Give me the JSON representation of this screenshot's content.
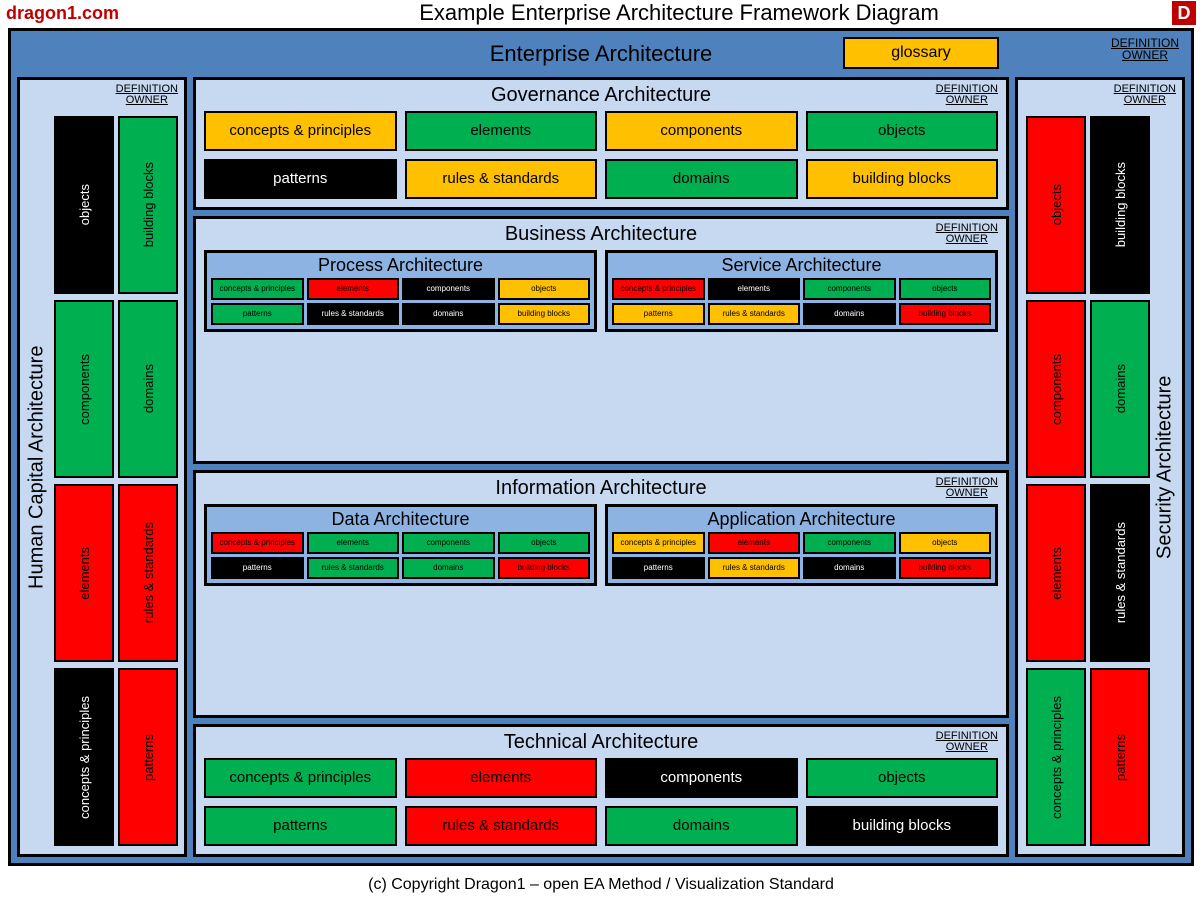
{
  "brand": "dragon1.com",
  "logo": "D",
  "page_title": "Example Enterprise Architecture Framework Diagram",
  "footer": "(c) Copyright Dragon1 – open EA Method / Visualization Standard",
  "defown1": "DEFINITION",
  "defown2": "OWNER",
  "ea_title": "Enterprise Architecture",
  "glossary": "glossary",
  "blocks": {
    "cp": "concepts & principles",
    "el": "elements",
    "co": "components",
    "ob": "objects",
    "pa": "patterns",
    "rs": "rules & standards",
    "do": "domains",
    "bb": "building blocks"
  },
  "left": {
    "title": "Human Capital Architecture",
    "pairs": [
      [
        {
          "k": "ob",
          "c": "black"
        },
        {
          "k": "bb",
          "c": "green"
        }
      ],
      [
        {
          "k": "co",
          "c": "green"
        },
        {
          "k": "do",
          "c": "green"
        }
      ],
      [
        {
          "k": "el",
          "c": "red"
        },
        {
          "k": "rs",
          "c": "red"
        }
      ],
      [
        {
          "k": "cp",
          "c": "black"
        },
        {
          "k": "pa",
          "c": "red"
        }
      ]
    ]
  },
  "right": {
    "title": "Security Architecture",
    "pairs": [
      [
        {
          "k": "ob",
          "c": "red"
        },
        {
          "k": "bb",
          "c": "black"
        }
      ],
      [
        {
          "k": "co",
          "c": "red"
        },
        {
          "k": "do",
          "c": "green"
        }
      ],
      [
        {
          "k": "el",
          "c": "red"
        },
        {
          "k": "rs",
          "c": "black"
        }
      ],
      [
        {
          "k": "cp",
          "c": "green"
        },
        {
          "k": "pa",
          "c": "red"
        }
      ]
    ]
  },
  "governance": {
    "title": "Governance Architecture",
    "items": [
      {
        "k": "cp",
        "c": "orange"
      },
      {
        "k": "el",
        "c": "green"
      },
      {
        "k": "co",
        "c": "orange"
      },
      {
        "k": "ob",
        "c": "green"
      },
      {
        "k": "pa",
        "c": "black"
      },
      {
        "k": "rs",
        "c": "orange"
      },
      {
        "k": "do",
        "c": "green"
      },
      {
        "k": "bb",
        "c": "orange"
      }
    ]
  },
  "business": {
    "title": "Business Architecture",
    "left": {
      "title": "Process Architecture",
      "items": [
        {
          "k": "cp",
          "c": "green"
        },
        {
          "k": "el",
          "c": "red"
        },
        {
          "k": "co",
          "c": "black"
        },
        {
          "k": "ob",
          "c": "orange"
        },
        {
          "k": "pa",
          "c": "green"
        },
        {
          "k": "rs",
          "c": "black"
        },
        {
          "k": "do",
          "c": "black"
        },
        {
          "k": "bb",
          "c": "orange"
        }
      ]
    },
    "right": {
      "title": "Service Architecture",
      "items": [
        {
          "k": "cp",
          "c": "red"
        },
        {
          "k": "el",
          "c": "black"
        },
        {
          "k": "co",
          "c": "green"
        },
        {
          "k": "ob",
          "c": "green"
        },
        {
          "k": "pa",
          "c": "orange"
        },
        {
          "k": "rs",
          "c": "orange"
        },
        {
          "k": "do",
          "c": "black"
        },
        {
          "k": "bb",
          "c": "red"
        }
      ]
    }
  },
  "information": {
    "title": "Information Architecture",
    "left": {
      "title": "Data Architecture",
      "items": [
        {
          "k": "cp",
          "c": "red"
        },
        {
          "k": "el",
          "c": "green"
        },
        {
          "k": "co",
          "c": "green"
        },
        {
          "k": "ob",
          "c": "green"
        },
        {
          "k": "pa",
          "c": "black"
        },
        {
          "k": "rs",
          "c": "green"
        },
        {
          "k": "do",
          "c": "green"
        },
        {
          "k": "bb",
          "c": "red"
        }
      ]
    },
    "right": {
      "title": "Application Architecture",
      "items": [
        {
          "k": "cp",
          "c": "orange"
        },
        {
          "k": "el",
          "c": "red"
        },
        {
          "k": "co",
          "c": "green"
        },
        {
          "k": "ob",
          "c": "orange"
        },
        {
          "k": "pa",
          "c": "black"
        },
        {
          "k": "rs",
          "c": "orange"
        },
        {
          "k": "do",
          "c": "black"
        },
        {
          "k": "bb",
          "c": "red"
        }
      ]
    }
  },
  "technical": {
    "title": "Technical Architecture",
    "items": [
      {
        "k": "cp",
        "c": "green"
      },
      {
        "k": "el",
        "c": "red"
      },
      {
        "k": "co",
        "c": "black"
      },
      {
        "k": "ob",
        "c": "green"
      },
      {
        "k": "pa",
        "c": "green"
      },
      {
        "k": "rs",
        "c": "red"
      },
      {
        "k": "do",
        "c": "green"
      },
      {
        "k": "bb",
        "c": "black"
      }
    ]
  }
}
